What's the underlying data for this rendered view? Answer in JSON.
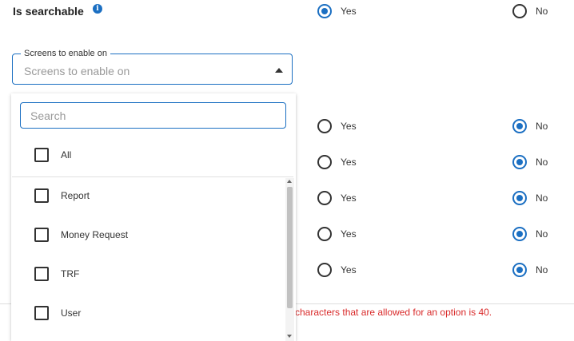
{
  "searchable": {
    "title": "Is searchable",
    "info_icon": "i",
    "yes_label": "Yes",
    "no_label": "No",
    "selected": "yes"
  },
  "screens": {
    "legend": "Screens to enable on",
    "placeholder": "Screens to enable on"
  },
  "dropdown": {
    "search_placeholder": "Search",
    "options": [
      "All",
      "Report",
      "Money Request",
      "TRF",
      "User"
    ]
  },
  "radio_rows": [
    {
      "yes": "Yes",
      "no": "No",
      "selected": "no"
    },
    {
      "yes": "Yes",
      "no": "No",
      "selected": "no"
    },
    {
      "yes": "Yes",
      "no": "No",
      "selected": "no"
    },
    {
      "yes": "Yes",
      "no": "No",
      "selected": "no"
    },
    {
      "yes": "Yes",
      "no": "No",
      "selected": "no"
    }
  ],
  "error": {
    "text": "characters that are allowed for an option is 40."
  },
  "colors": {
    "accent": "#1b6fc2",
    "error": "#d92b2b"
  }
}
